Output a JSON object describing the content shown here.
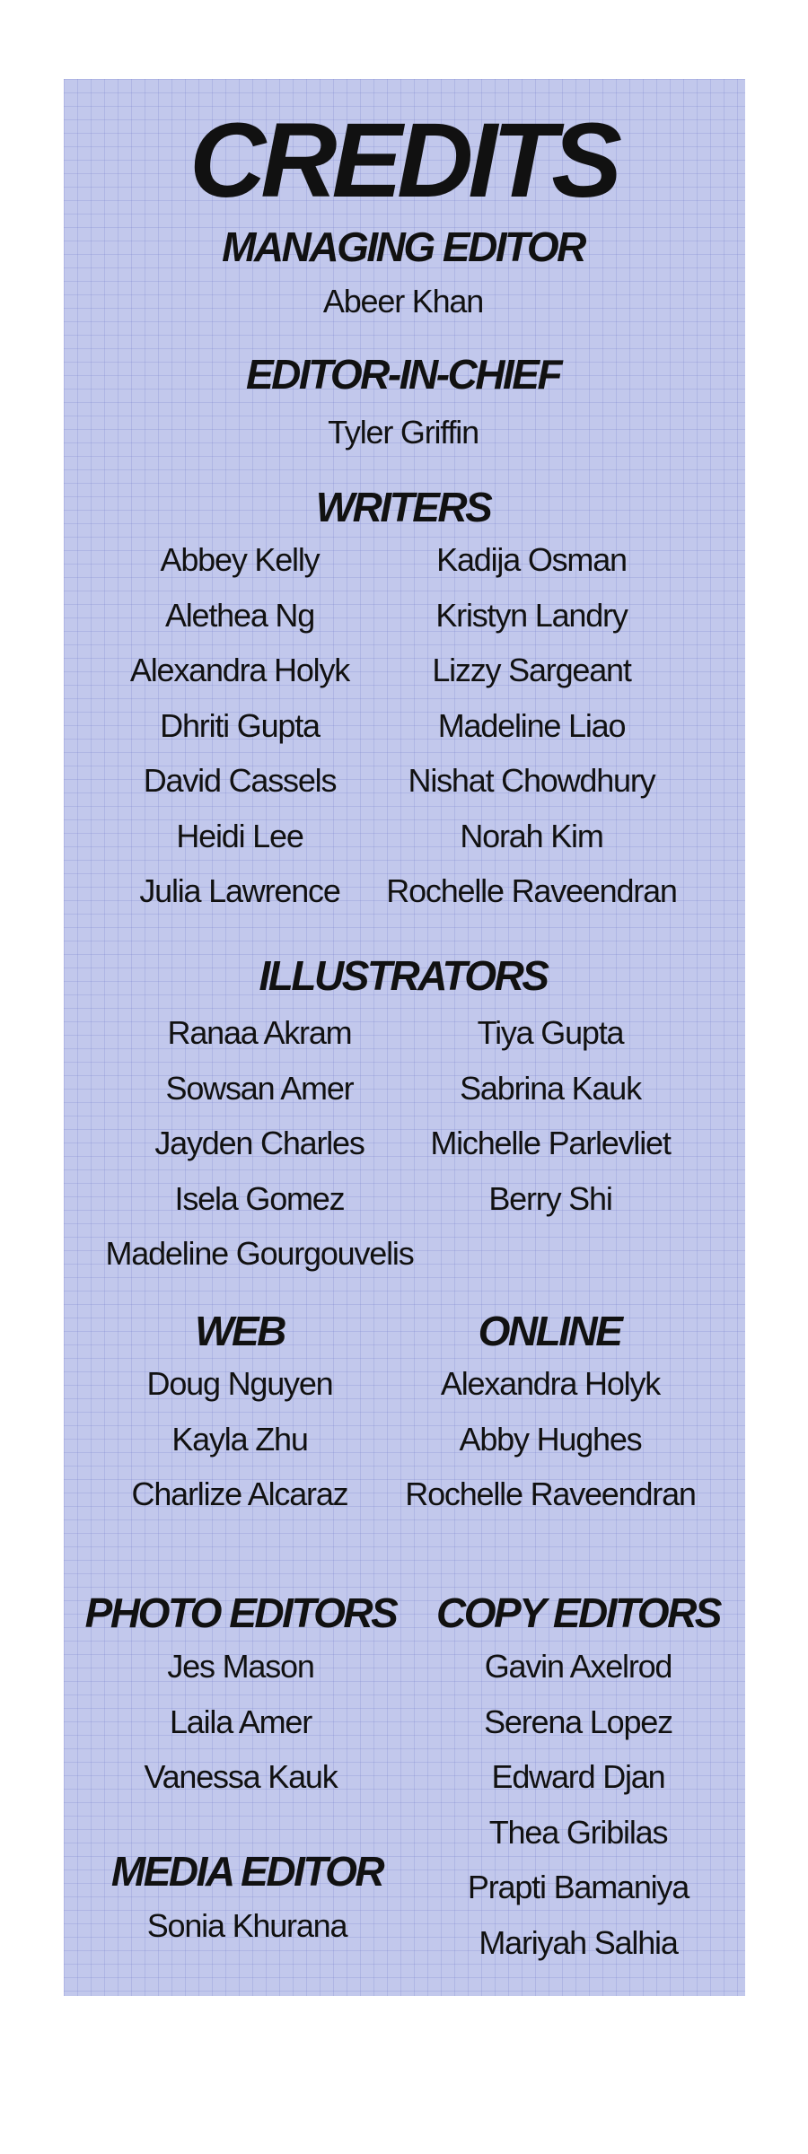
{
  "title": "CREDITS",
  "managing_editor": {
    "heading": "MANAGING EDITOR",
    "name": "Abeer Khan"
  },
  "editor_in_chief": {
    "heading": "EDITOR-IN-CHIEF",
    "name": "Tyler Griffin"
  },
  "writers": {
    "heading": "WRITERS",
    "left": [
      "Abbey Kelly",
      "Alethea Ng",
      "Alexandra Holyk",
      "Dhriti Gupta",
      "David Cassels",
      "Heidi Lee",
      "Julia Lawrence"
    ],
    "right": [
      "Kadija Osman",
      "Kristyn Landry",
      "Lizzy Sargeant",
      "Madeline Liao",
      "Nishat Chowdhury",
      "Norah Kim",
      "Rochelle Raveendran"
    ]
  },
  "illustrators": {
    "heading": "ILLUSTRATORS",
    "left": [
      "Ranaa Akram",
      "Sowsan Amer",
      "Jayden Charles",
      "Isela Gomez",
      "Madeline Gourgouvelis"
    ],
    "right": [
      "Tiya Gupta",
      "Sabrina Kauk",
      "Michelle Parlevliet",
      "Berry Shi"
    ]
  },
  "web": {
    "heading": "WEB",
    "names": [
      "Doug Nguyen",
      "Kayla Zhu",
      "Charlize Alcaraz"
    ]
  },
  "online": {
    "heading": "ONLINE",
    "names": [
      "Alexandra Holyk",
      "Abby Hughes",
      "Rochelle Raveendran"
    ]
  },
  "photo_editors": {
    "heading": "PHOTO EDITORS",
    "names": [
      "Jes Mason",
      "Laila Amer",
      "Vanessa Kauk"
    ]
  },
  "copy_editors": {
    "heading": "COPY EDITORS",
    "names": [
      "Gavin Axelrod",
      "Serena Lopez",
      "Edward Djan",
      "Thea Gribilas",
      "Prapti Bamaniya",
      "Mariyah Salhia"
    ]
  },
  "media_editor": {
    "heading": "MEDIA EDITOR",
    "name": "Sonia Khurana"
  }
}
